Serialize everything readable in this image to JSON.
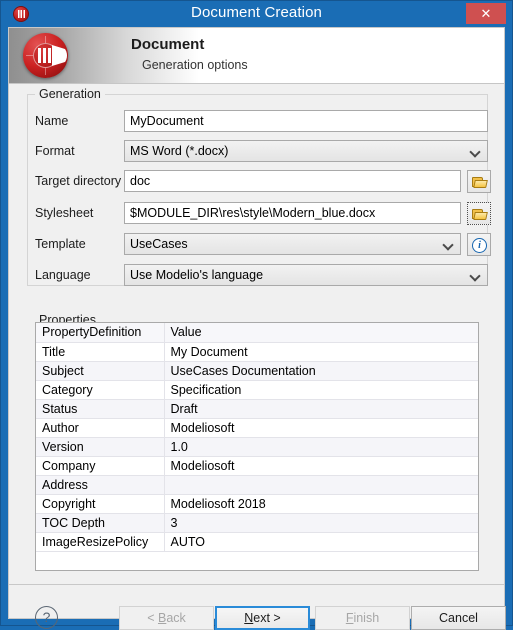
{
  "window": {
    "title": "Document Creation",
    "icon": "modelio-logo-icon",
    "close_label": "✕"
  },
  "banner": {
    "title": "Document",
    "subtitle": "Generation options",
    "logo": "modelio-logo-icon"
  },
  "generation": {
    "group_label": "Generation",
    "fields": [
      {
        "label": "Name",
        "value": "MyDocument",
        "type": "text"
      },
      {
        "label": "Format",
        "value": "MS Word (*.docx)",
        "type": "combo"
      },
      {
        "label": "Target directory",
        "value": "doc",
        "type": "text"
      },
      {
        "label": "Stylesheet",
        "value": "$MODULE_DIR\\res\\style\\Modern_blue.docx",
        "type": "text"
      },
      {
        "label": "Template",
        "value": "UseCases",
        "type": "combo"
      },
      {
        "label": "Language",
        "value": "Use Modelio's language",
        "type": "combo"
      }
    ],
    "browse_target_icon": "folder-open-icon",
    "browse_stylesheet_icon": "folder-open-icon",
    "template_info_icon": "info-icon",
    "info_glyph": "i"
  },
  "properties": {
    "group_label": "Properties",
    "columns": [
      "PropertyDefinition",
      "Value"
    ],
    "rows": [
      {
        "name": "Title",
        "value": "My Document"
      },
      {
        "name": "Subject",
        "value": "UseCases Documentation"
      },
      {
        "name": "Category",
        "value": "Specification"
      },
      {
        "name": "Status",
        "value": "Draft"
      },
      {
        "name": "Author",
        "value": "Modeliosoft"
      },
      {
        "name": "Version",
        "value": "1.0"
      },
      {
        "name": "Company",
        "value": "Modeliosoft"
      },
      {
        "name": "Address",
        "value": ""
      },
      {
        "name": "Copyright",
        "value": "Modeliosoft 2018"
      },
      {
        "name": "TOC Depth",
        "value": "3"
      },
      {
        "name": "ImageResizePolicy",
        "value": "AUTO"
      }
    ]
  },
  "footer": {
    "help_glyph": "?",
    "back_label": "< Back",
    "next_label": "Next >",
    "finish_label": "Finish",
    "cancel_label": "Cancel"
  },
  "colors": {
    "frame_blue": "#1a6db5",
    "close_red": "#cf5050",
    "focus_blue": "#2a8bd8",
    "logo_red": "#cc2222"
  }
}
